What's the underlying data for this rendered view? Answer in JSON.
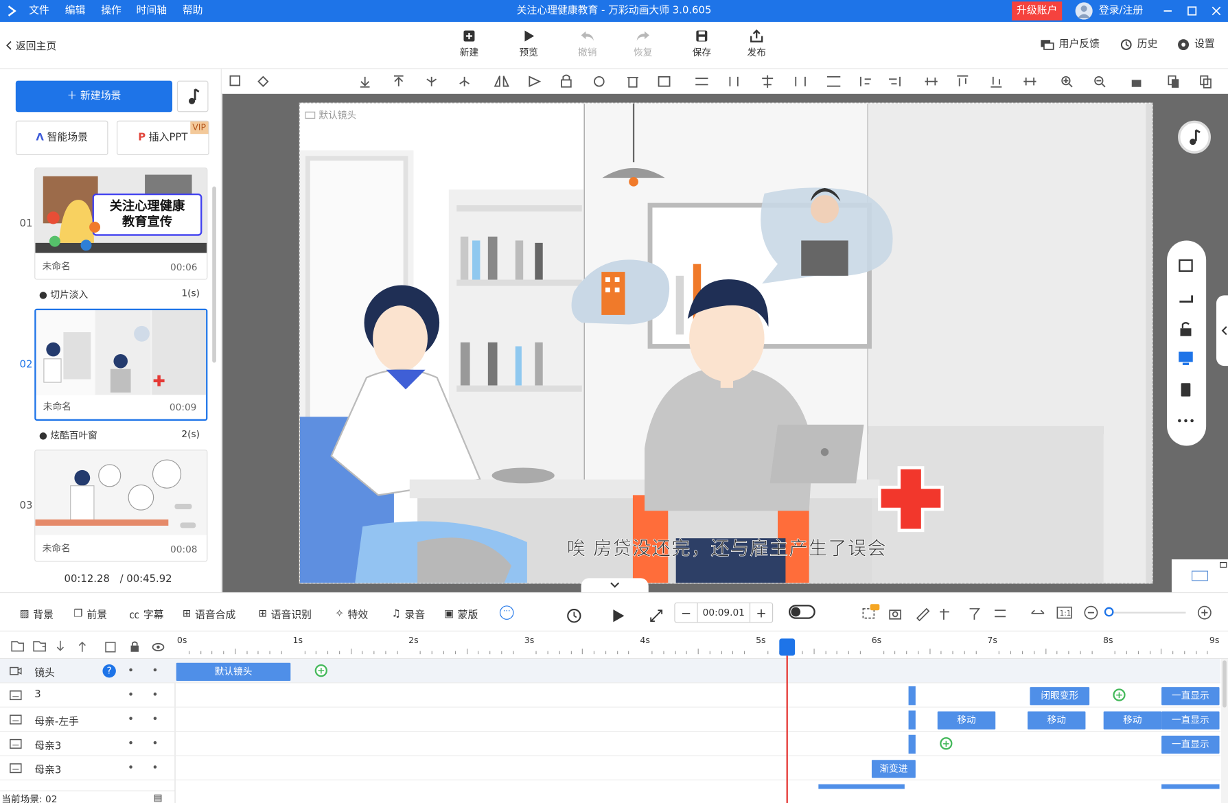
{
  "titlebar": {
    "menus": [
      "文件",
      "编辑",
      "操作",
      "时间轴",
      "帮助"
    ],
    "title": "关注心理健康教育 - 万彩动画大师 3.0.605",
    "upgrade": "升级账户",
    "login": "登录/注册"
  },
  "toolbar": {
    "back": "返回主页",
    "buttons": [
      "新建",
      "预览",
      "撤销",
      "恢复",
      "保存",
      "发布"
    ],
    "feedback": "用户反馈",
    "history": "历史",
    "settings": "设置"
  },
  "left": {
    "new_scene": "新建场景",
    "smart_scene": "智能场景",
    "insert_ppt": "插入PPT",
    "vip": "VIP",
    "scenes": [
      {
        "num": "01",
        "name": "未命名",
        "duration": "00:06",
        "thumb_title_1": "关注心理健康",
        "thumb_title_2": "教育宣传"
      },
      {
        "num": "02",
        "name": "未命名",
        "duration": "00:09"
      },
      {
        "num": "03",
        "name": "未命名",
        "duration": "00:08"
      }
    ],
    "transitions": [
      {
        "name": "切片淡入",
        "dur": "1(s)"
      },
      {
        "name": "炫酷百叶窗",
        "dur": "2(s)"
      }
    ],
    "time_current": "00:12.28",
    "time_total": "/ 00:45.92"
  },
  "canvas": {
    "camera_label": "默认镜头",
    "subtitle": "唉  房贷没还完，还与雇主产生了误会"
  },
  "timeline": {
    "tools": [
      "背景",
      "前景",
      "字幕",
      "语音合成",
      "语音识别",
      "特效",
      "录音",
      "蒙版"
    ],
    "time": "00:09.01",
    "ruler": [
      "0s",
      "1s",
      "2s",
      "3s",
      "4s",
      "5s",
      "6s",
      "7s",
      "8s",
      "9s"
    ],
    "playhead_time_s": 5.27,
    "tracks": [
      {
        "name": "镜头"
      },
      {
        "name": "3"
      },
      {
        "name": "母亲-左手"
      },
      {
        "name": "母亲3"
      },
      {
        "name": "母亲3"
      }
    ],
    "clips": {
      "camera": "默认镜头",
      "t1_a": "闭眼变形",
      "t1_b": "一直显示",
      "t2_a": "移动",
      "t2_b": "移动",
      "t2_c": "移动",
      "t2_d": "一直显示",
      "t3_a": "一直显示",
      "t4_a": "渐变进"
    },
    "current_scene": "当前场景: 02"
  }
}
